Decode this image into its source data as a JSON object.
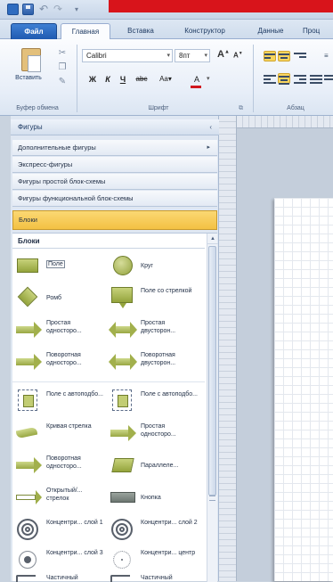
{
  "ribbon": {
    "tabs": [
      "Файл",
      "Главная",
      "Вставка",
      "Конструктор",
      "Данные",
      "Проц"
    ],
    "clipboard": {
      "paste_label": "Вставить",
      "group_label": "Буфер обмена"
    },
    "font": {
      "name": "Calibri",
      "size": "8пт",
      "group_label": "Шрифт",
      "case_label": "Aa"
    },
    "paragraph": {
      "group_label": "Абзац"
    }
  },
  "shapes_pane": {
    "title": "Фигуры",
    "stencils": [
      "Дополнительные фигуры",
      "Экспресс-фигуры",
      "Фигуры простой блок-схемы",
      "Фигуры функциональной блок-схемы",
      "Блоки"
    ],
    "active_stencil": "Блоки",
    "section_title": "Блоки",
    "shapes": [
      {
        "label": "Поле",
        "icon": "rectangle-shape-icon"
      },
      {
        "label": "Круг",
        "icon": "circle-shape-icon"
      },
      {
        "label": "Ромб",
        "icon": "diamond-shape-icon"
      },
      {
        "label": "Поле со стрелкой",
        "icon": "callout-shape-icon"
      },
      {
        "label": "Простая односторо...",
        "icon": "one-way-arrow-icon"
      },
      {
        "label": "Простая двусторон...",
        "icon": "two-way-arrow-icon"
      },
      {
        "label": "Поворотная односторо...",
        "icon": "one-way-arrow-icon"
      },
      {
        "label": "Поворотная двусторон...",
        "icon": "two-way-arrow-icon"
      },
      {
        "label": "Поле с автоподбо...",
        "icon": "autosize-box-icon"
      },
      {
        "label": "Поле с автоподбо...",
        "icon": "autosize-box-icon"
      },
      {
        "label": "Кривая стрелка",
        "icon": "curved-arrow-icon"
      },
      {
        "label": "Простая односторо...",
        "icon": "one-way-arrow-icon"
      },
      {
        "label": "Поворотная односторо...",
        "icon": "one-way-arrow-icon"
      },
      {
        "label": "Параллеле...",
        "icon": "parallelogram-shape-icon"
      },
      {
        "label": "Открытый/... стрелок",
        "icon": "open-arrow-icon"
      },
      {
        "label": "Кнопка",
        "icon": "button-shape-icon"
      },
      {
        "label": "Концентри... слой 1",
        "icon": "concentric-ring-icon"
      },
      {
        "label": "Концентри... слой 2",
        "icon": "concentric-ring-icon"
      },
      {
        "label": "Концентри... слой 3",
        "icon": "concentric-dot-icon"
      },
      {
        "label": "Концентри... центр",
        "icon": "concentric-center-icon"
      },
      {
        "label": "Частичный",
        "icon": "partial-layer-icon"
      },
      {
        "label": "Частичный",
        "icon": "partial-layer-icon"
      }
    ]
  },
  "colors": {
    "accent": "#1f5bb1",
    "active_stencil": "#f3c143",
    "shape_fill": "#a9b653",
    "title_bar": "#d8141b"
  }
}
